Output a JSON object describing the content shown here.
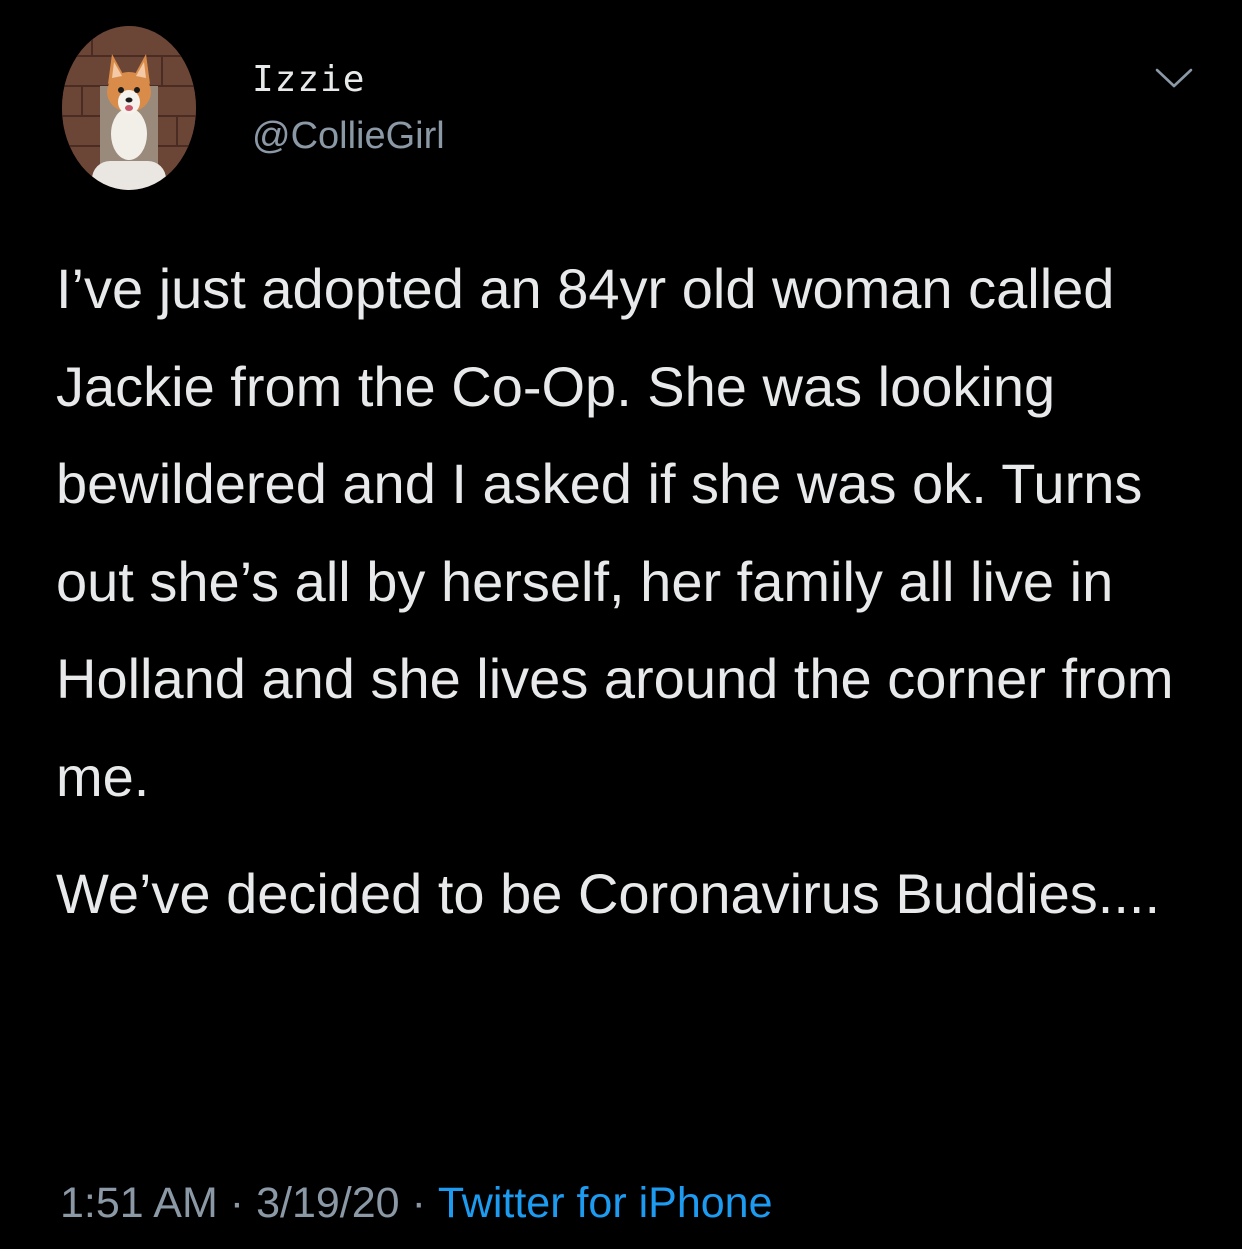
{
  "tweet": {
    "display_name": "Izzie",
    "handle": "@CollieGirl",
    "paragraphs": [
      "I’ve just adopted an 84yr old woman called Jackie from the Co-Op. She was looking bewildered and I asked if she was ok. Turns out she’s all by herself, her family all live in Holland and she lives around the corner from me.",
      "We’ve decided to be Coronavirus Buddies...."
    ],
    "time": "1:51 AM",
    "date": "3/19/20",
    "separator": "·",
    "source": "Twitter for iPhone"
  },
  "icons": {
    "avatar": "corgi-avatar",
    "menu": "chevron-down-icon"
  },
  "colors": {
    "background": "#000000",
    "text": "#e7e9ea",
    "secondary": "#8b98a5",
    "link": "#1d9bf0"
  }
}
